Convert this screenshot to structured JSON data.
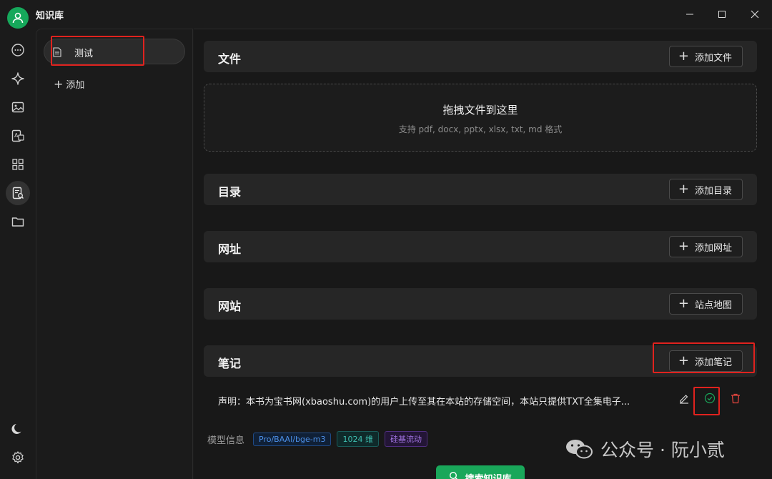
{
  "app": {
    "title": "知识库"
  },
  "knowledge_base": {
    "items": [
      {
        "label": "测试"
      }
    ],
    "add_label": "添加"
  },
  "sections": {
    "files": {
      "title": "文件",
      "button": "添加文件"
    },
    "dropzone": {
      "title": "拖拽文件到这里",
      "subtitle": "支持 pdf, docx, pptx, xlsx, txt, md 格式"
    },
    "directory": {
      "title": "目录",
      "button": "添加目录"
    },
    "url": {
      "title": "网址",
      "button": "添加网址"
    },
    "website": {
      "title": "网站",
      "button": "站点地图"
    },
    "notes": {
      "title": "笔记",
      "button": "添加笔记"
    }
  },
  "notes": [
    {
      "text": "声明：本书为宝书网(xbaoshu.com)的用户上传至其在本站的存储空间，本站只提供TXT全集电子..."
    }
  ],
  "model": {
    "label": "模型信息",
    "name": "Pro/BAAI/bge-m3",
    "dimension": "1024 维",
    "provider": "硅基流动"
  },
  "search_button": "搜索知识库",
  "watermark": {
    "text": "公众号 · 阮小贰"
  },
  "colors": {
    "accent": "#19a75a",
    "highlight_border": "#e0221e",
    "delete": "#e0443e"
  }
}
